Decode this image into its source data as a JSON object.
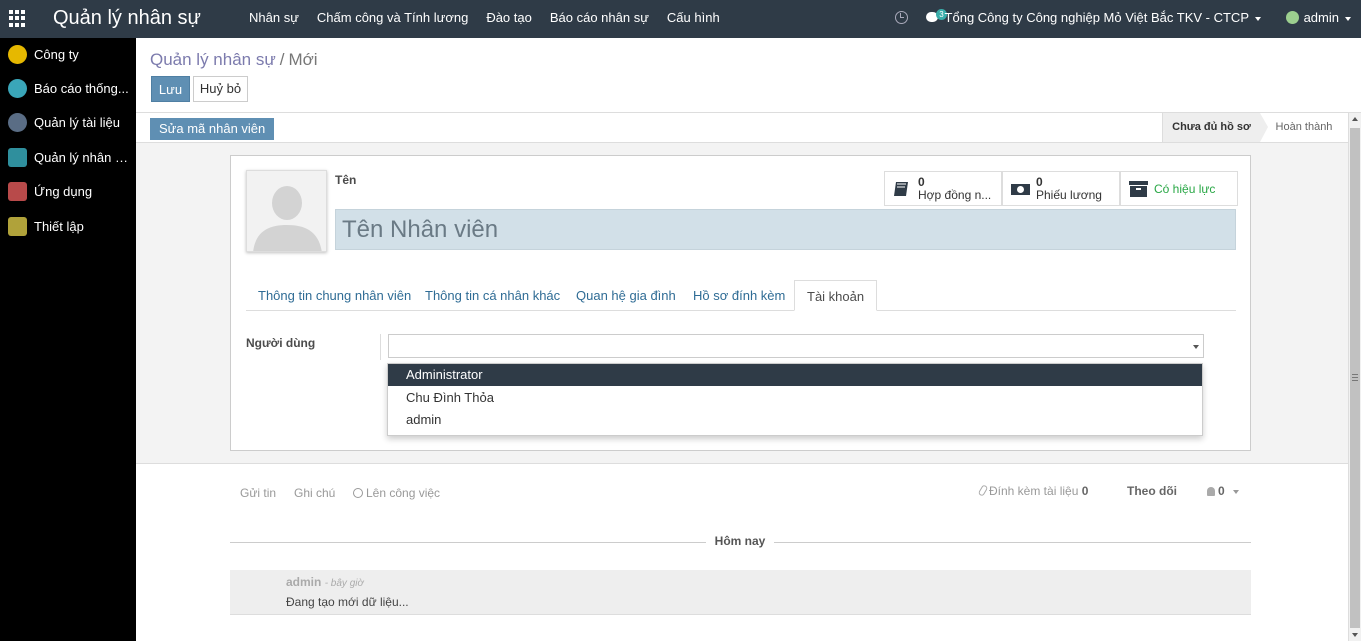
{
  "app": {
    "title": "Quản lý nhân sự"
  },
  "topmenu": [
    {
      "label": "Nhân sự"
    },
    {
      "label": "Chấm công và Tính lương"
    },
    {
      "label": "Đào tạo"
    },
    {
      "label": "Báo cáo nhân sự"
    },
    {
      "label": "Cấu hình"
    }
  ],
  "systray": {
    "chat_count": "3",
    "company": "Tổng Công ty Công nghiệp Mỏ Việt Bắc TKV - CTCP",
    "user": "admin"
  },
  "sidebar": {
    "items": [
      {
        "label": "Công ty",
        "icon": "company-icon",
        "color": "#e6b800"
      },
      {
        "label": "Báo cáo thống...",
        "icon": "chart-icon",
        "color": "#3aa6b9"
      },
      {
        "label": "Quản lý tài liệu",
        "icon": "document-icon",
        "color": "#5a6d85"
      },
      {
        "label": "Quản lý nhân sự",
        "icon": "people-icon",
        "color": "#2f8f9d"
      },
      {
        "label": "Ứng dụng",
        "icon": "apps-icon",
        "color": "#b84a4a"
      },
      {
        "label": "Thiết lập",
        "icon": "gear-icon",
        "color": "#b0a23a"
      }
    ]
  },
  "breadcrumb": {
    "parent": "Quản lý nhân sự",
    "separator": "/",
    "current": "Mới"
  },
  "buttons": {
    "save": "Lưu",
    "discard": "Huỷ bỏ",
    "edit_code": "Sửa mã nhân viên"
  },
  "statusbar": {
    "current": "Chưa đủ hồ sơ",
    "next": "Hoàn thành"
  },
  "form": {
    "name_label": "Tên",
    "name_placeholder": "Tên Nhân viên",
    "smart_buttons": [
      {
        "num": "0",
        "label": "Hợp đồng n...",
        "icon": "book-icon"
      },
      {
        "num": "0",
        "label": "Phiếu lương",
        "icon": "money-icon"
      },
      {
        "label": "Có hiệu lực",
        "icon": "archive-icon"
      }
    ],
    "tabs": [
      {
        "label": "Thông tin chung nhân viên"
      },
      {
        "label": "Thông tin cá nhân khác"
      },
      {
        "label": "Quan hệ gia đình"
      },
      {
        "label": "Hồ sơ đính kèm"
      },
      {
        "label": "Tài khoản"
      }
    ],
    "user_field_label": "Người dùng",
    "user_field_value": "",
    "dropdown_options": [
      {
        "label": "Administrator"
      },
      {
        "label": "Chu Đình Thỏa"
      },
      {
        "label": "admin"
      }
    ]
  },
  "chatter": {
    "send_message": "Gửi tin",
    "log_note": "Ghi chú",
    "schedule_activity": "Lên công việc",
    "attachments_label": "Đính kèm tài liệu",
    "attachments_count": "0",
    "follow": "Theo dõi",
    "followers_count": "0",
    "today": "Hôm nay",
    "message": {
      "author": "admin",
      "time": "- bây giờ",
      "body": "Đang tạo mới dữ liệu..."
    }
  },
  "colors": {
    "topbar": "#2f3b47",
    "primary_button": "#5f8fb3",
    "active_status": "#28a745"
  }
}
